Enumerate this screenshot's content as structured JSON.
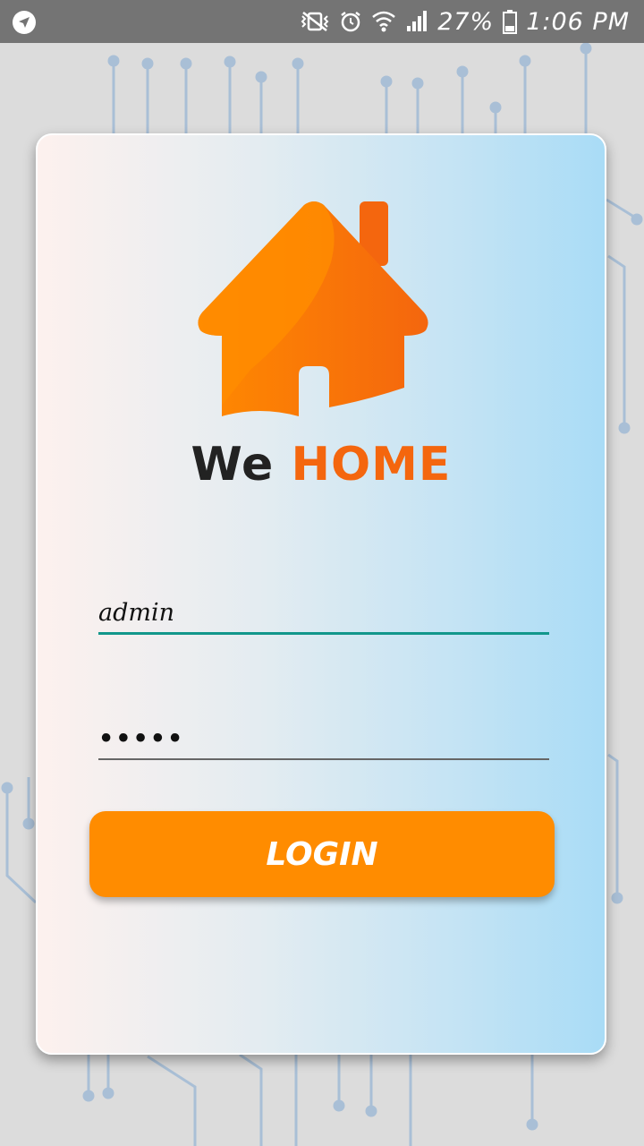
{
  "status_bar": {
    "battery": "27%",
    "time": "1:06 PM",
    "icons": [
      "location-arrow-icon",
      "vibrate-mute-icon",
      "alarm-icon",
      "wifi-icon",
      "signal-icon",
      "battery-icon"
    ]
  },
  "brand": {
    "word1": "We",
    "word2": "HOME",
    "colors": {
      "dark": "#222222",
      "accent": "#f4660e"
    },
    "logo_icon": "house-icon"
  },
  "login_form": {
    "username": {
      "value": "admin"
    },
    "password": {
      "value": "•••••"
    },
    "login_button": {
      "label": "LOGIN",
      "color": "#ff8c00"
    },
    "focus_underline_color": "#12978b"
  }
}
